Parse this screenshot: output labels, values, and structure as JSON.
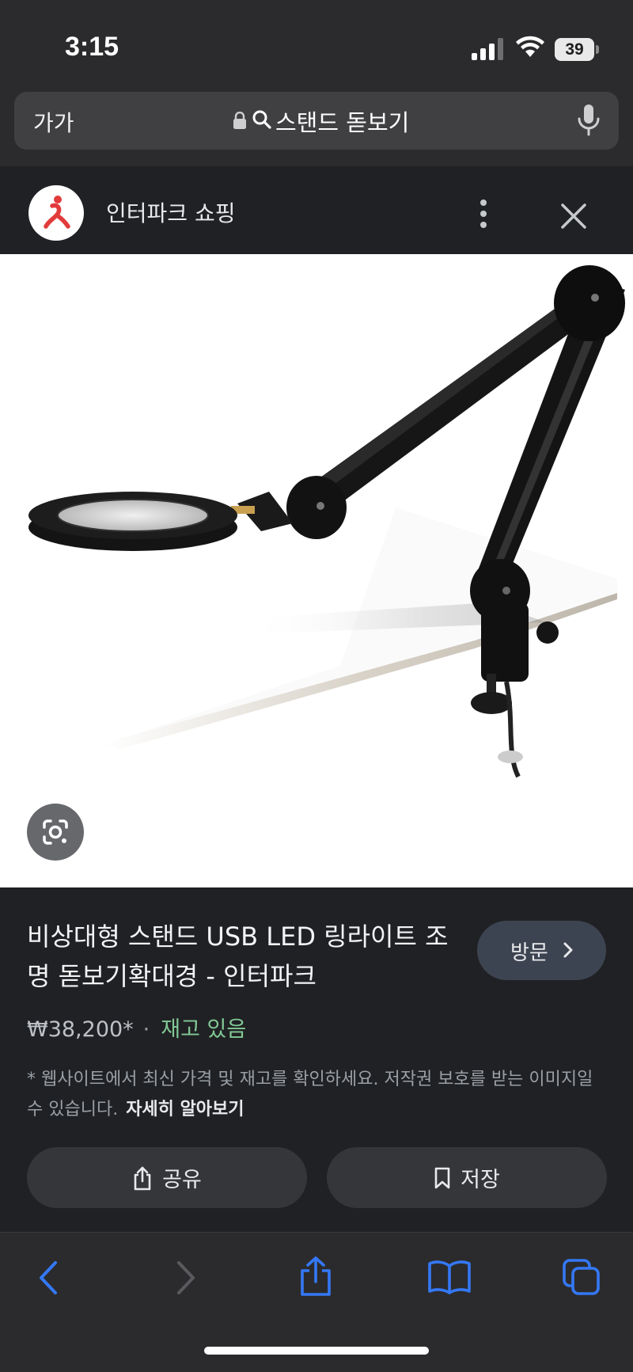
{
  "status_bar": {
    "time": "3:15",
    "battery": "39",
    "icons": [
      "cellular-signal-icon",
      "wifi-icon",
      "battery-icon"
    ]
  },
  "address_bar": {
    "text_size_label": "가가",
    "url_text": "스탠드 돋보기",
    "icons": [
      "lock-icon",
      "search-icon",
      "microphone-icon"
    ]
  },
  "merchant": {
    "name": "인터파크 쇼핑",
    "icons": [
      "interpark-logo",
      "more-vert-icon",
      "close-icon"
    ]
  },
  "product": {
    "image_desc_icon": "desk-magnifier-lamp",
    "lens_icon": "lens-search-icon",
    "title": "비상대형 스탠드 USB LED 링라이트 조명 돋보기확대경 - 인터파크",
    "visit_label": "방문",
    "price": "₩38,200*",
    "price_separator": "·",
    "stock": "재고 있음",
    "disclaimer": "* 웹사이트에서 최신 가격 및 재고를 확인하세요. 저작권 보호를 받는 이미지일 수 있습니다.",
    "learn_more": "자세히 알아보기",
    "share_label": "공유",
    "save_label": "저장"
  },
  "bottom_toolbar": {
    "icons": [
      "back-icon",
      "forward-icon",
      "share-icon",
      "bookmarks-icon",
      "tabs-icon"
    ]
  },
  "colors": {
    "accent_blue": "#3478f6",
    "stock_green": "#81c995",
    "background": "#202124"
  }
}
